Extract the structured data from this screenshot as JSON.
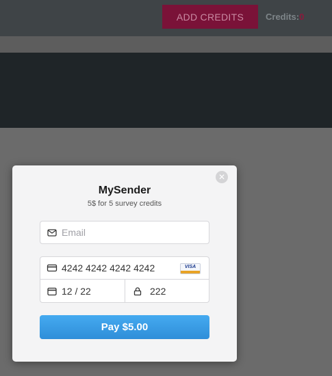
{
  "header": {
    "add_credits_label": "ADD CREDITS",
    "credits_label": "Credits:",
    "credits_count": "0"
  },
  "modal": {
    "title": "MySender",
    "subtitle": "5$ for 5 survey credits",
    "close_icon": "close-icon",
    "email_placeholder": "Email",
    "card_number": "4242 4242 4242 4242",
    "card_brand": "VISA",
    "expiry": "12 / 22",
    "cvc": "222",
    "pay_label": "Pay $5.00"
  },
  "colors": {
    "pay_button": "#3a9ee6",
    "add_credits_button": "#7a1238",
    "credits_count": "#8b1a3c"
  }
}
